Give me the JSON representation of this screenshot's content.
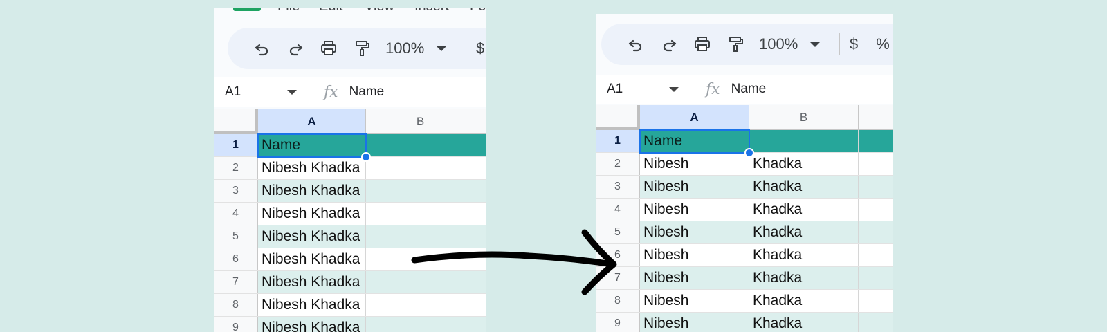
{
  "colors": {
    "header_fill": "#26a69a",
    "band_fill": "#dcefed",
    "selection_blue": "#1a73e8",
    "background": "#d6ebe9"
  },
  "left": {
    "menu": [
      "File",
      "Edit",
      "View",
      "Insert",
      "Fo"
    ],
    "toolbar": {
      "icons": [
        "undo-icon",
        "redo-icon",
        "print-icon",
        "paint-format-icon"
      ],
      "zoom": "100%",
      "tail": [
        "$"
      ]
    },
    "namebox": "A1",
    "formula_value": "Name",
    "columns": [
      "A",
      "B"
    ],
    "rows": [
      {
        "num": "1",
        "a": "Name",
        "b": ""
      },
      {
        "num": "2",
        "a": "Nibesh  Khadka",
        "b": ""
      },
      {
        "num": "3",
        "a": "Nibesh Khadka",
        "b": ""
      },
      {
        "num": "4",
        "a": "Nibesh Khadka",
        "b": ""
      },
      {
        "num": "5",
        "a": "Nibesh Khadka",
        "b": ""
      },
      {
        "num": "6",
        "a": "Nibesh Khadka",
        "b": ""
      },
      {
        "num": "7",
        "a": "Nibesh Khadka",
        "b": ""
      },
      {
        "num": "8",
        "a": "Nibesh Khadka",
        "b": ""
      },
      {
        "num": "9",
        "a": "Nibesh Khadka",
        "b": ""
      }
    ]
  },
  "right": {
    "toolbar": {
      "icons": [
        "undo-icon",
        "redo-icon",
        "print-icon",
        "paint-format-icon"
      ],
      "zoom": "100%",
      "tail": [
        "$",
        "%"
      ]
    },
    "namebox": "A1",
    "formula_value": "Name",
    "columns": [
      "A",
      "B"
    ],
    "rows": [
      {
        "num": "1",
        "a": "Name",
        "b": ""
      },
      {
        "num": "2",
        "a": "Nibesh",
        "b": "Khadka"
      },
      {
        "num": "3",
        "a": "Nibesh",
        "b": "Khadka"
      },
      {
        "num": "4",
        "a": "Nibesh",
        "b": "Khadka"
      },
      {
        "num": "5",
        "a": "Nibesh",
        "b": "Khadka"
      },
      {
        "num": "6",
        "a": "Nibesh",
        "b": "Khadka"
      },
      {
        "num": "7",
        "a": "Nibesh",
        "b": "Khadka"
      },
      {
        "num": "8",
        "a": "Nibesh",
        "b": "Khadka"
      },
      {
        "num": "9",
        "a": "Nibesh",
        "b": "Khadka"
      }
    ]
  }
}
